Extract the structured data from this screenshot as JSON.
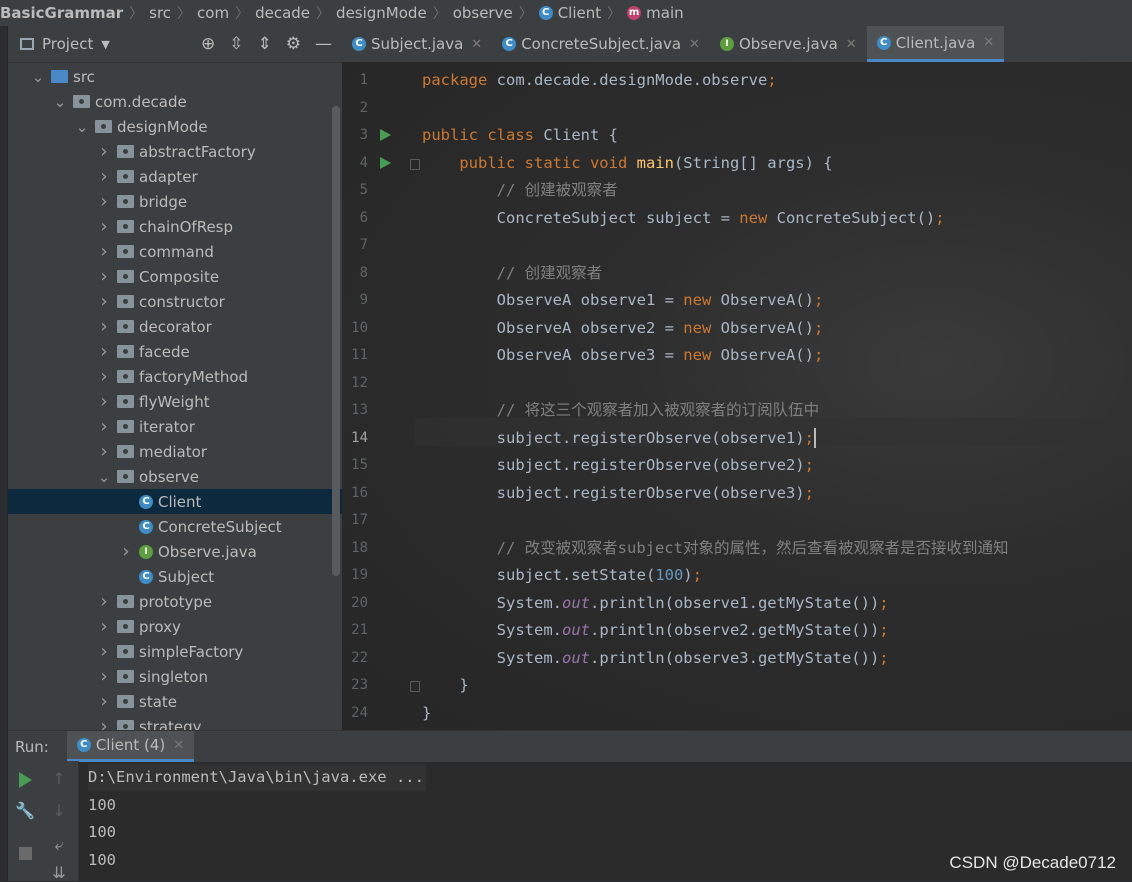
{
  "breadcrumb": [
    {
      "label": "BasicGrammar",
      "icon": ""
    },
    {
      "label": "src",
      "icon": ""
    },
    {
      "label": "com",
      "icon": ""
    },
    {
      "label": "decade",
      "icon": ""
    },
    {
      "label": "designMode",
      "icon": ""
    },
    {
      "label": "observe",
      "icon": ""
    },
    {
      "label": "Client",
      "icon": "class-icon"
    },
    {
      "label": "main",
      "icon": "method-icon"
    }
  ],
  "project": {
    "title": "Project",
    "tree": [
      {
        "label": "src",
        "indent": 0,
        "arrow": "open",
        "icon": "source-folder-icon"
      },
      {
        "label": "com.decade",
        "indent": 1,
        "arrow": "open",
        "icon": "package-icon"
      },
      {
        "label": "designMode",
        "indent": 2,
        "arrow": "open",
        "icon": "package-icon"
      },
      {
        "label": "abstractFactory",
        "indent": 3,
        "arrow": "closed",
        "icon": "package-icon"
      },
      {
        "label": "adapter",
        "indent": 3,
        "arrow": "closed",
        "icon": "package-icon"
      },
      {
        "label": "bridge",
        "indent": 3,
        "arrow": "closed",
        "icon": "package-icon"
      },
      {
        "label": "chainOfResp",
        "indent": 3,
        "arrow": "closed",
        "icon": "package-icon"
      },
      {
        "label": "command",
        "indent": 3,
        "arrow": "closed",
        "icon": "package-icon"
      },
      {
        "label": "Composite",
        "indent": 3,
        "arrow": "closed",
        "icon": "package-icon"
      },
      {
        "label": "constructor",
        "indent": 3,
        "arrow": "closed",
        "icon": "package-icon"
      },
      {
        "label": "decorator",
        "indent": 3,
        "arrow": "closed",
        "icon": "package-icon"
      },
      {
        "label": "facede",
        "indent": 3,
        "arrow": "closed",
        "icon": "package-icon"
      },
      {
        "label": "factoryMethod",
        "indent": 3,
        "arrow": "closed",
        "icon": "package-icon"
      },
      {
        "label": "flyWeight",
        "indent": 3,
        "arrow": "closed",
        "icon": "package-icon"
      },
      {
        "label": "iterator",
        "indent": 3,
        "arrow": "closed",
        "icon": "package-icon"
      },
      {
        "label": "mediator",
        "indent": 3,
        "arrow": "closed",
        "icon": "package-icon"
      },
      {
        "label": "observe",
        "indent": 3,
        "arrow": "open",
        "icon": "package-icon"
      },
      {
        "label": "Client",
        "indent": 4,
        "arrow": "none",
        "icon": "class-icon",
        "selected": true
      },
      {
        "label": "ConcreteSubject",
        "indent": 4,
        "arrow": "none",
        "icon": "class-icon"
      },
      {
        "label": "Observe.java",
        "indent": 4,
        "arrow": "closed",
        "icon": "interface-icon"
      },
      {
        "label": "Subject",
        "indent": 4,
        "arrow": "none",
        "icon": "class-icon"
      },
      {
        "label": "prototype",
        "indent": 3,
        "arrow": "closed",
        "icon": "package-icon"
      },
      {
        "label": "proxy",
        "indent": 3,
        "arrow": "closed",
        "icon": "package-icon"
      },
      {
        "label": "simpleFactory",
        "indent": 3,
        "arrow": "closed",
        "icon": "package-icon"
      },
      {
        "label": "singleton",
        "indent": 3,
        "arrow": "closed",
        "icon": "package-icon"
      },
      {
        "label": "state",
        "indent": 3,
        "arrow": "closed",
        "icon": "package-icon"
      },
      {
        "label": "strategy",
        "indent": 3,
        "arrow": "closed",
        "icon": "package-icon"
      }
    ]
  },
  "tabs": [
    {
      "label": "Subject.java",
      "icon": "class-icon",
      "active": false
    },
    {
      "label": "ConcreteSubject.java",
      "icon": "class-icon",
      "active": false
    },
    {
      "label": "Observe.java",
      "icon": "interface-icon",
      "active": false
    },
    {
      "label": "Client.java",
      "icon": "class-icon",
      "active": true
    }
  ],
  "editor": {
    "current_line": 14,
    "run_marker_lines": [
      3,
      4
    ],
    "fold_marker_lines": [
      4,
      23
    ],
    "lines": [
      [
        [
          "kw",
          "package "
        ],
        [
          "p",
          "com.decade.designMode.observe"
        ],
        [
          "kw",
          ";"
        ]
      ],
      [],
      [
        [
          "kw",
          "public class "
        ],
        [
          "p",
          "Client {"
        ]
      ],
      [
        [
          "p",
          "    "
        ],
        [
          "kw",
          "public static void "
        ],
        [
          "fn",
          "main"
        ],
        [
          "p",
          "(String[] args) {"
        ]
      ],
      [
        [
          "p",
          "        "
        ],
        [
          "cm",
          "// 创建被观察者"
        ]
      ],
      [
        [
          "p",
          "        ConcreteSubject subject = "
        ],
        [
          "kw",
          "new "
        ],
        [
          "p",
          "ConcreteSubject()"
        ],
        [
          "kw",
          ";"
        ]
      ],
      [],
      [
        [
          "p",
          "        "
        ],
        [
          "cm",
          "// 创建观察者"
        ]
      ],
      [
        [
          "p",
          "        ObserveA observe1 = "
        ],
        [
          "kw",
          "new "
        ],
        [
          "p",
          "ObserveA()"
        ],
        [
          "kw",
          ";"
        ]
      ],
      [
        [
          "p",
          "        ObserveA observe2 = "
        ],
        [
          "kw",
          "new "
        ],
        [
          "p",
          "ObserveA()"
        ],
        [
          "kw",
          ";"
        ]
      ],
      [
        [
          "p",
          "        ObserveA observe3 = "
        ],
        [
          "kw",
          "new "
        ],
        [
          "p",
          "ObserveA()"
        ],
        [
          "kw",
          ";"
        ]
      ],
      [],
      [
        [
          "p",
          "        "
        ],
        [
          "cm",
          "// 将这三个观察者加入被观察者的订阅队伍中"
        ]
      ],
      [
        [
          "p",
          "        subject.registerObserve(observe1)"
        ],
        [
          "kw",
          ";"
        ],
        [
          "caret",
          ""
        ]
      ],
      [
        [
          "p",
          "        subject.registerObserve(observe2)"
        ],
        [
          "kw",
          ";"
        ]
      ],
      [
        [
          "p",
          "        subject.registerObserve(observe3)"
        ],
        [
          "kw",
          ";"
        ]
      ],
      [],
      [
        [
          "p",
          "        "
        ],
        [
          "cm",
          "// 改变被观察者subject对象的属性，然后查看被观察者是否接收到通知"
        ]
      ],
      [
        [
          "p",
          "        subject.setState("
        ],
        [
          "num",
          "100"
        ],
        [
          "p",
          ")"
        ],
        [
          "kw",
          ";"
        ]
      ],
      [
        [
          "p",
          "        System."
        ],
        [
          "st",
          "out"
        ],
        [
          "p",
          ".println(observe1.getMyState())"
        ],
        [
          "kw",
          ";"
        ]
      ],
      [
        [
          "p",
          "        System."
        ],
        [
          "st",
          "out"
        ],
        [
          "p",
          ".println(observe2.getMyState())"
        ],
        [
          "kw",
          ";"
        ]
      ],
      [
        [
          "p",
          "        System."
        ],
        [
          "st",
          "out"
        ],
        [
          "p",
          ".println(observe3.getMyState())"
        ],
        [
          "kw",
          ";"
        ]
      ],
      [
        [
          "p",
          "    }"
        ]
      ],
      [
        [
          "p",
          "}"
        ]
      ]
    ]
  },
  "run": {
    "label": "Run:",
    "tab_label": "Client (4)",
    "console": [
      "D:\\Environment\\Java\\bin\\java.exe ...",
      "100",
      "100",
      "100"
    ]
  },
  "watermark": "CSDN @Decade0712",
  "colors": {
    "keyword": "#cc7832",
    "method": "#ffc66d",
    "comment": "#808080",
    "number": "#6897bb",
    "static_field": "#9876aa",
    "plain": "#a9b7c6",
    "selection": "#0d293e",
    "accent": "#4a88c7",
    "run_green": "#499c54"
  }
}
